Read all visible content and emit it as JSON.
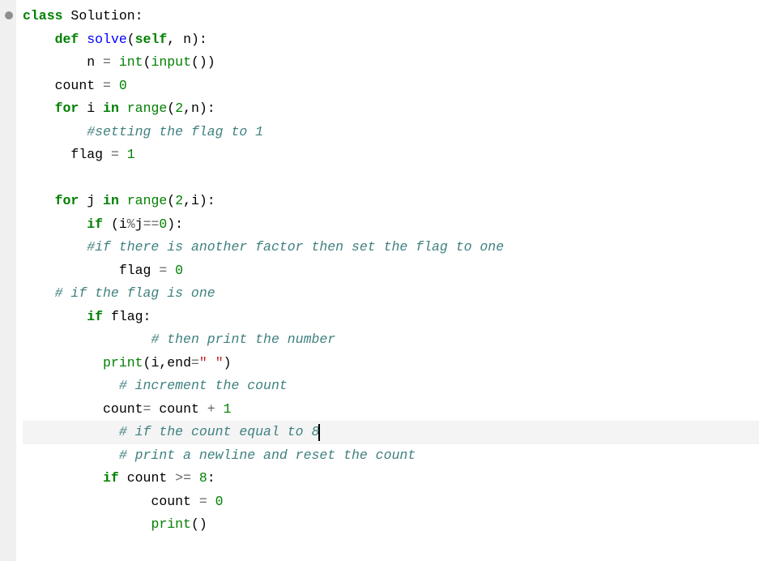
{
  "code": {
    "lines": [
      {
        "indent": 0,
        "tokens": [
          {
            "t": "kw",
            "v": "class"
          },
          {
            "t": "sp",
            "v": " "
          },
          {
            "t": "cls",
            "v": "Solution"
          },
          {
            "t": "paren",
            "v": ":"
          }
        ]
      },
      {
        "indent": 4,
        "tokens": [
          {
            "t": "kw",
            "v": "def"
          },
          {
            "t": "sp",
            "v": " "
          },
          {
            "t": "def",
            "v": "solve"
          },
          {
            "t": "paren",
            "v": "("
          },
          {
            "t": "builtin bold",
            "v": "self"
          },
          {
            "t": "paren",
            "v": ","
          },
          {
            "t": "sp",
            "v": " "
          },
          {
            "t": "name",
            "v": "n"
          },
          {
            "t": "paren",
            "v": "):"
          }
        ]
      },
      {
        "indent": 8,
        "tokens": [
          {
            "t": "name",
            "v": "n"
          },
          {
            "t": "sp",
            "v": " "
          },
          {
            "t": "op",
            "v": "="
          },
          {
            "t": "sp",
            "v": " "
          },
          {
            "t": "builtin",
            "v": "int"
          },
          {
            "t": "paren",
            "v": "("
          },
          {
            "t": "builtin",
            "v": "input"
          },
          {
            "t": "paren",
            "v": "())"
          }
        ]
      },
      {
        "indent": 4,
        "tokens": [
          {
            "t": "name",
            "v": "count"
          },
          {
            "t": "sp",
            "v": " "
          },
          {
            "t": "op",
            "v": "="
          },
          {
            "t": "sp",
            "v": " "
          },
          {
            "t": "num",
            "v": "0"
          }
        ]
      },
      {
        "indent": 4,
        "tokens": [
          {
            "t": "kw",
            "v": "for"
          },
          {
            "t": "sp",
            "v": " "
          },
          {
            "t": "name",
            "v": "i"
          },
          {
            "t": "sp",
            "v": " "
          },
          {
            "t": "kw",
            "v": "in"
          },
          {
            "t": "sp",
            "v": " "
          },
          {
            "t": "builtin",
            "v": "range"
          },
          {
            "t": "paren",
            "v": "("
          },
          {
            "t": "num",
            "v": "2"
          },
          {
            "t": "paren",
            "v": ","
          },
          {
            "t": "name",
            "v": "n"
          },
          {
            "t": "paren",
            "v": "):"
          }
        ]
      },
      {
        "indent": 8,
        "tokens": [
          {
            "t": "comment",
            "v": "#setting the flag to 1"
          }
        ]
      },
      {
        "indent": 6,
        "tokens": [
          {
            "t": "name",
            "v": "flag"
          },
          {
            "t": "sp",
            "v": " "
          },
          {
            "t": "op",
            "v": "="
          },
          {
            "t": "sp",
            "v": " "
          },
          {
            "t": "num",
            "v": "1"
          }
        ]
      },
      {
        "indent": 0,
        "tokens": []
      },
      {
        "indent": 4,
        "tokens": [
          {
            "t": "kw",
            "v": "for"
          },
          {
            "t": "sp",
            "v": " "
          },
          {
            "t": "name",
            "v": "j"
          },
          {
            "t": "sp",
            "v": " "
          },
          {
            "t": "kw",
            "v": "in"
          },
          {
            "t": "sp",
            "v": " "
          },
          {
            "t": "builtin",
            "v": "range"
          },
          {
            "t": "paren",
            "v": "("
          },
          {
            "t": "num",
            "v": "2"
          },
          {
            "t": "paren",
            "v": ","
          },
          {
            "t": "name",
            "v": "i"
          },
          {
            "t": "paren",
            "v": "):"
          }
        ]
      },
      {
        "indent": 8,
        "tokens": [
          {
            "t": "kw",
            "v": "if"
          },
          {
            "t": "sp",
            "v": " "
          },
          {
            "t": "paren",
            "v": "("
          },
          {
            "t": "name",
            "v": "i"
          },
          {
            "t": "op",
            "v": "%"
          },
          {
            "t": "name",
            "v": "j"
          },
          {
            "t": "op",
            "v": "=="
          },
          {
            "t": "num",
            "v": "0"
          },
          {
            "t": "paren",
            "v": "):"
          }
        ]
      },
      {
        "indent": 8,
        "tokens": [
          {
            "t": "comment",
            "v": "#if there is another factor then set the flag to one"
          }
        ]
      },
      {
        "indent": 12,
        "tokens": [
          {
            "t": "name",
            "v": "flag"
          },
          {
            "t": "sp",
            "v": " "
          },
          {
            "t": "op",
            "v": "="
          },
          {
            "t": "sp",
            "v": " "
          },
          {
            "t": "num",
            "v": "0"
          }
        ]
      },
      {
        "indent": 4,
        "tokens": [
          {
            "t": "comment",
            "v": "# if the flag is one"
          }
        ]
      },
      {
        "indent": 8,
        "tokens": [
          {
            "t": "kw",
            "v": "if"
          },
          {
            "t": "sp",
            "v": " "
          },
          {
            "t": "name",
            "v": "flag"
          },
          {
            "t": "paren",
            "v": ":"
          }
        ]
      },
      {
        "indent": 16,
        "tokens": [
          {
            "t": "comment",
            "v": "# then print the number"
          }
        ]
      },
      {
        "indent": 10,
        "tokens": [
          {
            "t": "builtin",
            "v": "print"
          },
          {
            "t": "paren",
            "v": "("
          },
          {
            "t": "name",
            "v": "i"
          },
          {
            "t": "paren",
            "v": ","
          },
          {
            "t": "name",
            "v": "end"
          },
          {
            "t": "op",
            "v": "="
          },
          {
            "t": "str",
            "v": "\" \""
          },
          {
            "t": "paren",
            "v": ")"
          }
        ]
      },
      {
        "indent": 12,
        "tokens": [
          {
            "t": "comment",
            "v": "# increment the count"
          }
        ]
      },
      {
        "indent": 10,
        "tokens": [
          {
            "t": "name",
            "v": "count"
          },
          {
            "t": "op",
            "v": "="
          },
          {
            "t": "sp",
            "v": " "
          },
          {
            "t": "name",
            "v": "count"
          },
          {
            "t": "sp",
            "v": " "
          },
          {
            "t": "op",
            "v": "+"
          },
          {
            "t": "sp",
            "v": " "
          },
          {
            "t": "num",
            "v": "1"
          }
        ]
      },
      {
        "indent": 12,
        "highlighted": true,
        "caret": true,
        "tokens": [
          {
            "t": "comment",
            "v": "# if the count equal to 8"
          }
        ]
      },
      {
        "indent": 12,
        "tokens": [
          {
            "t": "comment",
            "v": "# print a newline and reset the count"
          }
        ]
      },
      {
        "indent": 10,
        "tokens": [
          {
            "t": "kw",
            "v": "if"
          },
          {
            "t": "sp",
            "v": " "
          },
          {
            "t": "name",
            "v": "count"
          },
          {
            "t": "sp",
            "v": " "
          },
          {
            "t": "op",
            "v": ">="
          },
          {
            "t": "sp",
            "v": " "
          },
          {
            "t": "num",
            "v": "8"
          },
          {
            "t": "paren",
            "v": ":"
          }
        ]
      },
      {
        "indent": 16,
        "tokens": [
          {
            "t": "name",
            "v": "count"
          },
          {
            "t": "sp",
            "v": " "
          },
          {
            "t": "op",
            "v": "="
          },
          {
            "t": "sp",
            "v": " "
          },
          {
            "t": "num",
            "v": "0"
          }
        ]
      },
      {
        "indent": 16,
        "tokens": [
          {
            "t": "builtin",
            "v": "print"
          },
          {
            "t": "paren",
            "v": "()"
          }
        ]
      }
    ]
  }
}
